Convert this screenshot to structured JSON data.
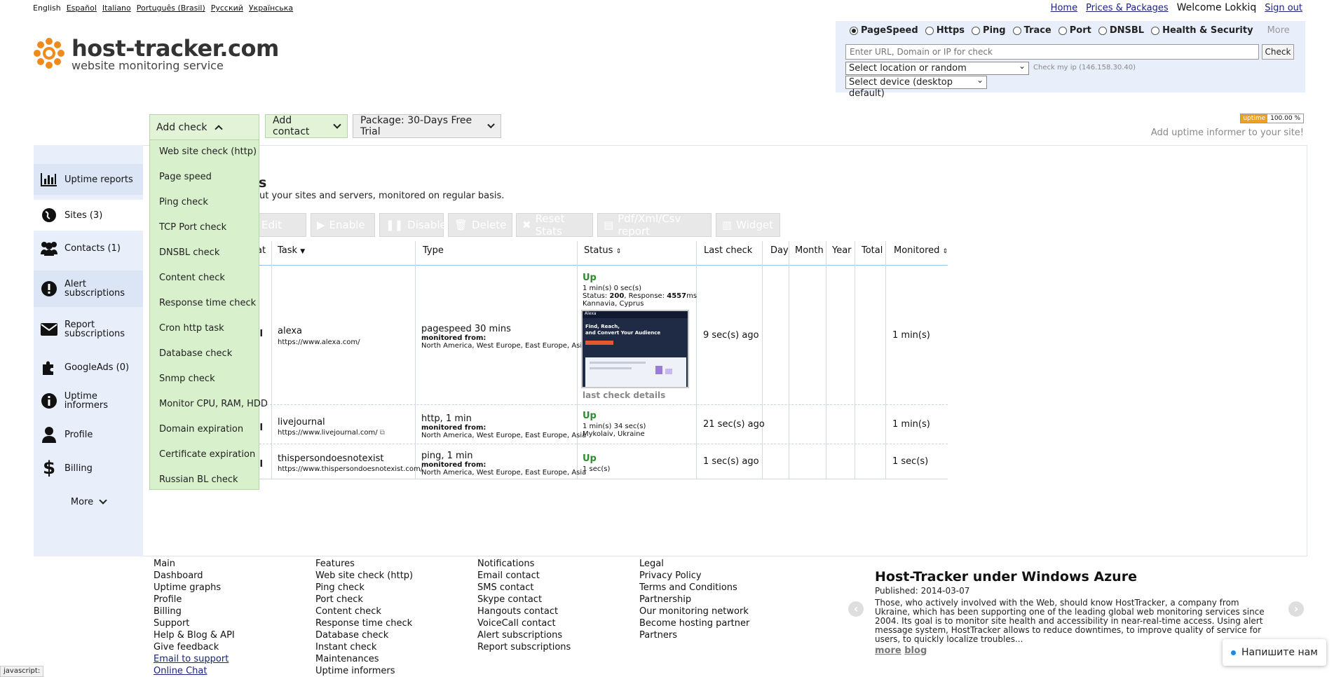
{
  "languages": [
    "English",
    "Español",
    "Italiano",
    "Português (Brasil)",
    "Русский",
    "Українська"
  ],
  "top_links": {
    "home": "Home",
    "prices": "Prices & Packages",
    "welcome": "Welcome Lokkiq",
    "signout": "Sign out"
  },
  "logo": {
    "brand": "host-tracker.com",
    "sub": "website monitoring service"
  },
  "check_panel": {
    "types": [
      "PageSpeed",
      "Https",
      "Ping",
      "Trace",
      "Port",
      "DNSBL",
      "Health & Security"
    ],
    "selected": "PageSpeed",
    "more": "More",
    "url_placeholder": "Enter URL, Domain or IP for check",
    "check_button": "Check",
    "location_select": "Select location or random",
    "check_my_ip": "Check my ip (146.158.30.40)",
    "device_select": "Select device (desktop default)"
  },
  "uptime_badge": {
    "label": "uptime",
    "value": "100.00 %"
  },
  "add_informer": "Add uptime informer to your site!",
  "top_buttons": {
    "add_check": "Add check",
    "add_contact": "Add contact",
    "package": "Package: 30-Days Free Trial"
  },
  "dropdown": [
    "Web site check (http)",
    "Page speed",
    "Ping check",
    "TCP Port check",
    "DNSBL check",
    "Content check",
    "Response time check",
    "Cron http task",
    "Database check",
    "Snmp check",
    "Monitor CPU, RAM, HDD",
    "Domain expiration",
    "Certificate expiration",
    "Russian BL check"
  ],
  "sidebar": [
    {
      "label": "Uptime reports",
      "icon": "bar-chart-icon"
    },
    {
      "label": "Sites (3)",
      "icon": "globe-icon"
    },
    {
      "label": "Contacts (1)",
      "icon": "users-icon"
    },
    {
      "label": "Alert subscriptions",
      "icon": "exclamation-icon"
    },
    {
      "label": "Report subscriptions",
      "icon": "envelope-icon"
    },
    {
      "label": "GoogleAds (0)",
      "icon": "puzzle-icon"
    },
    {
      "label": "Uptime informers",
      "icon": "info-icon"
    },
    {
      "label": "Profile",
      "icon": "user-icon"
    },
    {
      "label": "Billing",
      "icon": "dollar-icon"
    },
    {
      "label": "More",
      "icon": "chevron-down-icon"
    }
  ],
  "page": {
    "title_fragment": "s",
    "desc_fragment": "ut your sites and servers, monitored on regular basis."
  },
  "toolbar": [
    "Edit",
    "Enable",
    "Disable",
    "Delete",
    "Reset Stats",
    "Pdf/Xml/Csv report",
    "Widget"
  ],
  "table": {
    "headers": {
      "stat": "at",
      "task": "Task",
      "type": "Type",
      "status": "Status",
      "last": "Last check",
      "day": "Day",
      "month": "Month",
      "year": "Year",
      "total": "Total",
      "monitored": "Monitored"
    },
    "rows": [
      {
        "name": "alexa",
        "url": "https://www.alexa.com/",
        "type": "pagespeed 30 mins",
        "from_label": "monitored from:",
        "from": "North America, West Europe, East Europe, Asia",
        "status": "Up",
        "status_line1": "1 min(s) 0 sec(s)",
        "status_prefix": "Status: ",
        "status_code": "200",
        "response_prefix": ", Response: ",
        "response": "4557",
        "response_unit": "ms",
        "location": "Kannavia, Cyprus",
        "details": "last check details",
        "last": "9 sec(s) ago",
        "monitored": "1 min(s)"
      },
      {
        "name": "livejournal",
        "url": "https://www.livejournal.com/",
        "type": "http, 1 min",
        "from_label": "monitored from:",
        "from": "North America, West Europe, East Europe, Asia",
        "status": "Up",
        "status_line1": "1 min(s) 34 sec(s)",
        "location": "Mykolaiv, Ukraine",
        "last": "21 sec(s) ago",
        "monitored": "1 min(s)"
      },
      {
        "name": "thispersondoesnotexist",
        "url": "https://www.thispersondoesnotexist.com/",
        "type": "ping, 1 min",
        "from_label": "monitored from:",
        "from": "North America, West Europe, East Europe, Asia",
        "status": "Up",
        "status_line1": "1 sec(s)",
        "last": "1 sec(s) ago",
        "monitored": "1 sec(s)"
      }
    ]
  },
  "thumbnail": {
    "brand": "Alexa",
    "headline1": "Find, Reach,",
    "headline2": "and Convert Your Audience"
  },
  "footer": {
    "col1": [
      "Main",
      "Dashboard",
      "Uptime graphs",
      "Profile",
      "Billing",
      "Support",
      "Help & Blog & API",
      "Give feedback",
      "Email to support",
      "Online Chat"
    ],
    "col2": [
      "Features",
      "Web site check (http)",
      "Ping check",
      "Port check",
      "Content check",
      "Response time check",
      "Database check",
      "Instant check",
      "Maintenances",
      "Uptime informers"
    ],
    "col3": [
      "Notifications",
      "Email contact",
      "SMS contact",
      "Skype contact",
      "Hangouts contact",
      "VoiceCall contact",
      "Alert subscriptions",
      "Report subscriptions"
    ],
    "col4": [
      "Legal",
      "Privacy Policy",
      "Terms and Conditions",
      "Partnership",
      "Our monitoring network",
      "Become hosting partner",
      "Partners"
    ]
  },
  "news": {
    "title": "Host-Tracker under Windows Azure",
    "published": "Published: 2014-03-07",
    "body": "Those, who actively involved with the Web, should know HostTracker, a company from Ukraine, which has been supporting one of the leading global web monitoring services since 2004. Its goal is to monitor site health and accessibility in near-real-time access. Using alert message system, HostTracker allows to reduce downtimes, to improve quality of service for users, to quickly localize troubles...",
    "more": "more",
    "blog": "blog"
  },
  "chat": "Напишите нам",
  "statusbar": "javascript:"
}
